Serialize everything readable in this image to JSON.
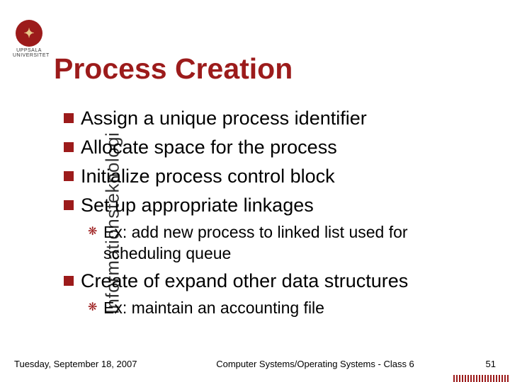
{
  "logo": {
    "uni_name": "UPPSALA UNIVERSITET"
  },
  "title": "Process Creation",
  "sidebar_label": "Informationsteknologi",
  "bullets": {
    "b0": "Assign a unique process identifier",
    "b1": "Allocate space for the process",
    "b2": "Initialize process control block",
    "b3": "Set up appropriate linkages",
    "b3_sub": "Ex: add new process to linked list used for scheduling queue",
    "b4": "Create of expand other data structures",
    "b4_sub": "Ex: maintain an accounting file"
  },
  "footer": {
    "date": "Tuesday, September 18, 2007",
    "course": "Computer Systems/Operating Systems - Class 6",
    "page": "51"
  }
}
